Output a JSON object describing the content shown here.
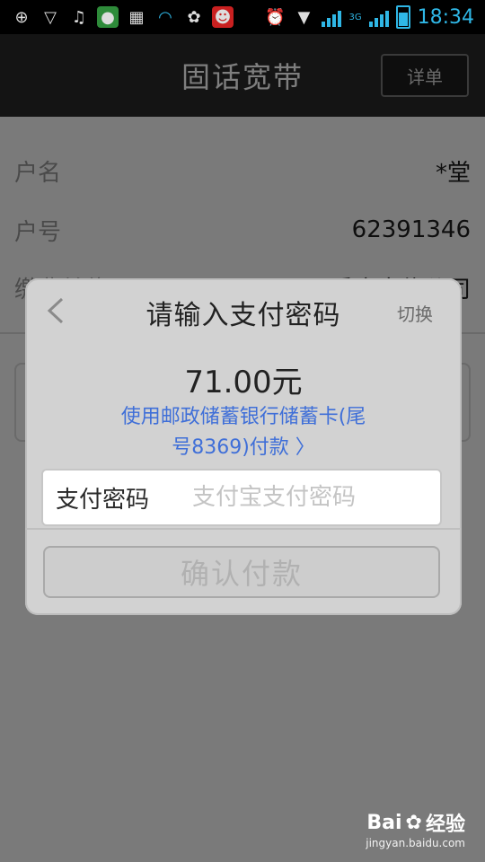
{
  "status": {
    "time": "18:34",
    "network": "3G"
  },
  "header": {
    "title": "固话宽带",
    "detail_label": "详单"
  },
  "background": {
    "rows": [
      {
        "label": "户名",
        "value": "*堂"
      },
      {
        "label": "户号",
        "value": "62391346"
      },
      {
        "label": "缴费单位",
        "value": "重庆电信公司"
      }
    ]
  },
  "dialog": {
    "title": "请输入支付密码",
    "switch_label": "切换",
    "amount": "71.00元",
    "pay_method_line1": "使用邮政储蓄银行储蓄卡(尾",
    "pay_method_line2": "号8369)付款 〉",
    "password_label": "支付密码",
    "password_placeholder": "支付宝支付密码",
    "confirm_label": "确认付款"
  },
  "watermark": {
    "brand": "Bai",
    "brand_suffix": "经验",
    "url": "jingyan.baidu.com"
  },
  "colors": {
    "accent_blue": "#3f6fd8",
    "status_blue": "#2fb7e6",
    "titlebar": "#141414"
  }
}
